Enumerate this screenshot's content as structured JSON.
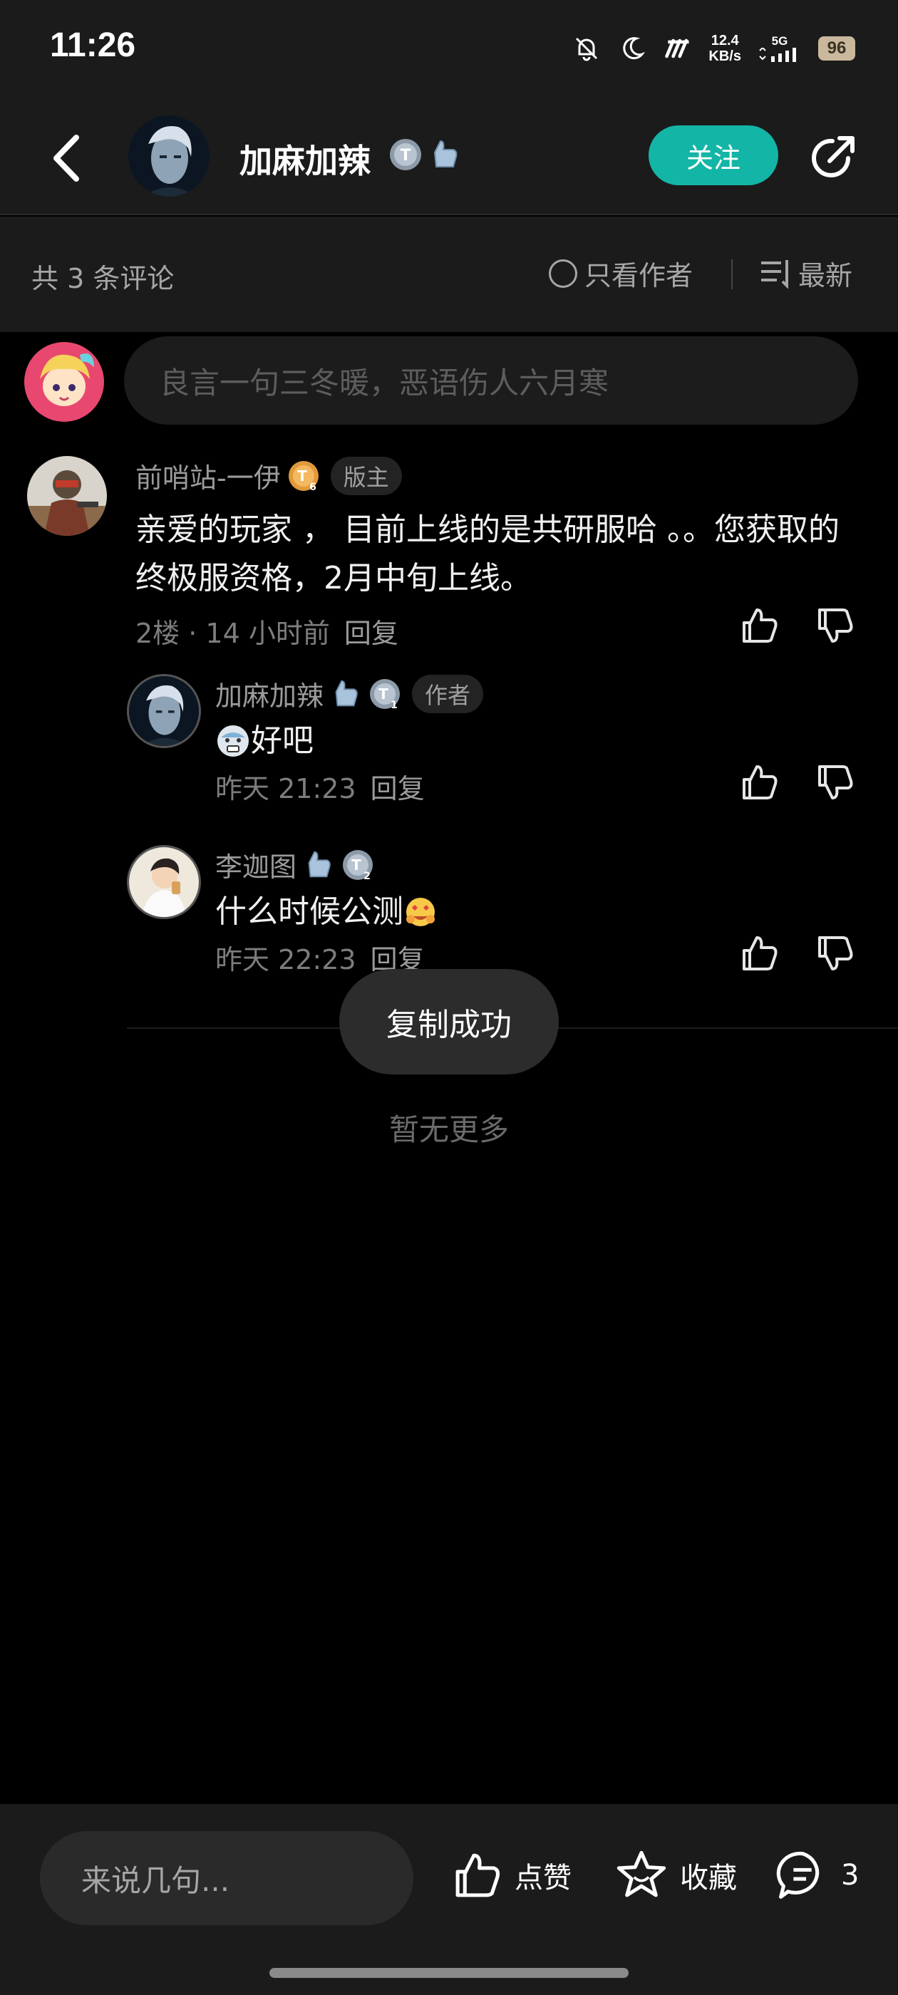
{
  "status_bar": {
    "time": "11:26",
    "net_speed_value": "12.4",
    "net_speed_unit": "KB/s",
    "signal_label": "5G",
    "battery": "96"
  },
  "header": {
    "title": "加麻加辣",
    "follow_label": "关注"
  },
  "filter": {
    "count_label": "共 3 条评论",
    "author_only_label": "只看作者",
    "sort_label": "最新"
  },
  "input": {
    "placeholder": "良言一句三冬暖，恶语伤人六月寒"
  },
  "comments": [
    {
      "user": "前哨站-一伊",
      "level": "6",
      "tag": "版主",
      "text": "亲爱的玩家 ， 目前上线的是共研服哈 。。您获取的终极服资格，2月中旬上线。",
      "meta": "2楼 · 14 小时前",
      "reply_label": "回复"
    },
    {
      "user": "加麻加辣",
      "level": "1",
      "tag": "作者",
      "text": "好吧",
      "meta": "昨天 21:23",
      "reply_label": "回复"
    },
    {
      "user": "李迦图",
      "level": "2",
      "text": "什么时候公测",
      "meta": "昨天 22:23",
      "reply_label": "回复"
    }
  ],
  "toast": "复制成功",
  "no_more": "暂无更多",
  "bottom_bar": {
    "input_placeholder": "来说几句...",
    "like_label": "点赞",
    "favorite_label": "收藏",
    "comment_count": "3"
  },
  "colors": {
    "accent": "#13b5a6",
    "background": "#000000",
    "bar_background": "#1b1b1b"
  }
}
